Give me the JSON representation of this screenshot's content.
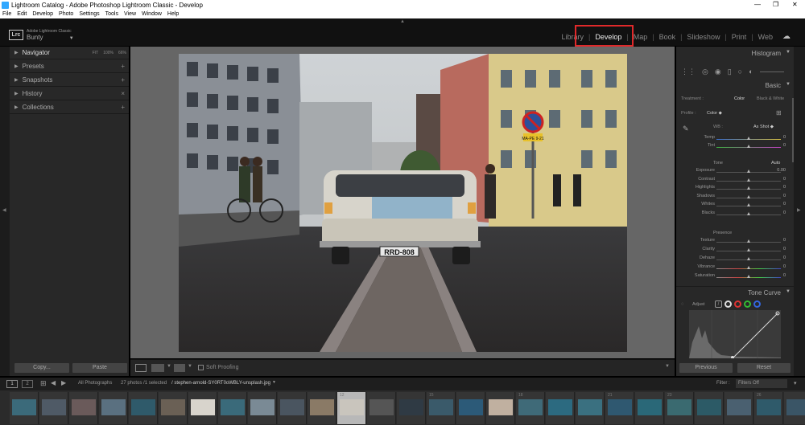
{
  "window": {
    "title": "Lightroom Catalog - Adobe Photoshop Lightroom Classic - Develop",
    "controls": [
      "—",
      "❐",
      "✕"
    ]
  },
  "menu": [
    "File",
    "Edit",
    "Develop",
    "Photo",
    "Settings",
    "Tools",
    "View",
    "Window",
    "Help"
  ],
  "identity": {
    "logo": "Lrc",
    "app": "Adobe Lightroom Classic",
    "name": "Bunty"
  },
  "modules": [
    "Library",
    "Develop",
    "Map",
    "Book",
    "Slideshow",
    "Print",
    "Web"
  ],
  "active_module": "Develop",
  "left_panel": {
    "navigator": {
      "label": "Navigator",
      "opts": [
        "FIT",
        "100%",
        "66%"
      ]
    },
    "sections": [
      {
        "label": "Presets",
        "action": "+"
      },
      {
        "label": "Snapshots",
        "action": "+"
      },
      {
        "label": "History",
        "action": "×"
      },
      {
        "label": "Collections",
        "action": "+"
      }
    ],
    "copy": "Copy...",
    "paste": "Paste"
  },
  "toolbar": {
    "soft_proofing": "Soft Proofing"
  },
  "photo": {
    "plate": "RRD-808",
    "sign": "MA-PE 9-21"
  },
  "right_panel": {
    "histogram": "Histogram",
    "basic": "Basic",
    "treatment_label": "Treatment :",
    "treatment_color": "Color",
    "treatment_bw": "Black & White",
    "profile_label": "Profile :",
    "profile_value": "Color",
    "wb_label": "WB :",
    "wb_value": "As Shot",
    "tone_label": "Tone",
    "tone_auto": "Auto",
    "presence_label": "Presence",
    "sliders_wb": [
      {
        "label": "Temp",
        "value": "0",
        "pos": 0.5
      },
      {
        "label": "Tint",
        "value": "0",
        "pos": 0.5
      }
    ],
    "sliders_tone": [
      {
        "label": "Exposure",
        "value": "0.00",
        "pos": 0.5
      },
      {
        "label": "Contrast",
        "value": "0",
        "pos": 0.5
      },
      {
        "label": "Highlights",
        "value": "0",
        "pos": 0.5
      },
      {
        "label": "Shadows",
        "value": "0",
        "pos": 0.5
      },
      {
        "label": "Whites",
        "value": "0",
        "pos": 0.5
      },
      {
        "label": "Blacks",
        "value": "0",
        "pos": 0.5
      }
    ],
    "sliders_presence": [
      {
        "label": "Texture",
        "value": "0",
        "pos": 0.5
      },
      {
        "label": "Clarity",
        "value": "0",
        "pos": 0.5
      },
      {
        "label": "Dehaze",
        "value": "0",
        "pos": 0.5
      },
      {
        "label": "Vibrance",
        "value": "0",
        "pos": 0.5
      },
      {
        "label": "Saturation",
        "value": "0",
        "pos": 0.5
      }
    ],
    "tone_curve": "Tone Curve",
    "adjust": "Adjust",
    "previous": "Previous",
    "reset": "Reset"
  },
  "filmbar": {
    "source": "All Photographs",
    "count": "27 photos /1 selected",
    "file": "/ stephen-arnold-SY0RT0oWBLY-unsplash.jpg",
    "filter_label": "Filter :",
    "filter_value": "Filters Off",
    "pages": [
      "1",
      "2"
    ]
  },
  "filmstrip": {
    "selected_index": 11,
    "labels": [
      "",
      "",
      "",
      "",
      "",
      "",
      "",
      "",
      "",
      "",
      "",
      "12",
      "",
      "",
      "15",
      "",
      "",
      "18",
      "",
      "",
      "21",
      "",
      "23",
      "",
      "",
      "26",
      ""
    ]
  }
}
